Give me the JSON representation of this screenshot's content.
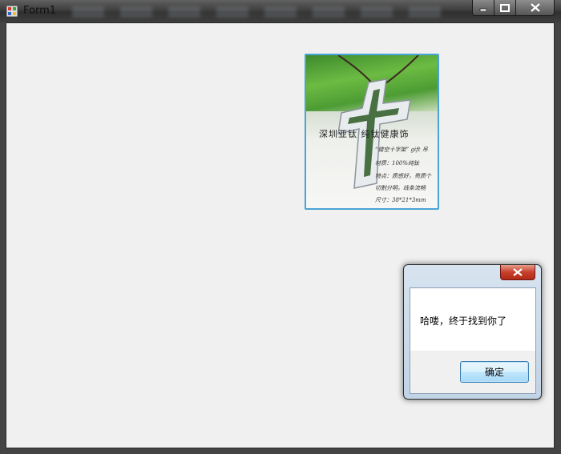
{
  "window": {
    "title": "Form1"
  },
  "picture": {
    "heading": "深圳亚钛 纯钛健康饰",
    "lines": [
      "“镂空十字架” gift 吊",
      "材质：100%纯钛",
      "特点：质感好，亮质个",
      "切割分明，线条流畅",
      "尺寸：38*21*3mm"
    ]
  },
  "dialog": {
    "message": "哈喽，终于找到你了",
    "ok_label": "确定"
  },
  "colors": {
    "accent": "#4aa3d6",
    "close_red": "#c7402c",
    "client_bg": "#f0f0f0"
  },
  "icons": {
    "app": "winform-app-icon",
    "minimize": "minimize-icon",
    "maximize": "maximize-icon",
    "close": "close-icon",
    "dialog_close": "close-icon"
  }
}
